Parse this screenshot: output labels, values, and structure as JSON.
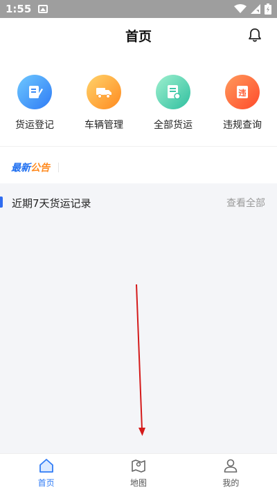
{
  "status_bar": {
    "time": "1:55"
  },
  "header": {
    "title": "首页"
  },
  "quick_menu": [
    {
      "label": "货运登记",
      "icon": "register-icon",
      "color": "#3d8bf5"
    },
    {
      "label": "车辆管理",
      "icon": "truck-icon",
      "color": "#ff9a2e"
    },
    {
      "label": "全部货运",
      "icon": "document-icon",
      "color": "#3cc7a7"
    },
    {
      "label": "违规查询",
      "icon": "violation-icon",
      "color": "#ff5b33"
    }
  ],
  "notice": {
    "part1": "最新",
    "part2": "公告"
  },
  "records": {
    "title": "近期7天货运记录",
    "more": "查看全部"
  },
  "tabbar": [
    {
      "label": "首页",
      "active": true
    },
    {
      "label": "地图",
      "active": false
    },
    {
      "label": "我的",
      "active": false
    }
  ],
  "colors": {
    "accent": "#2f7bf5",
    "background_gray": "#f4f5f8"
  }
}
